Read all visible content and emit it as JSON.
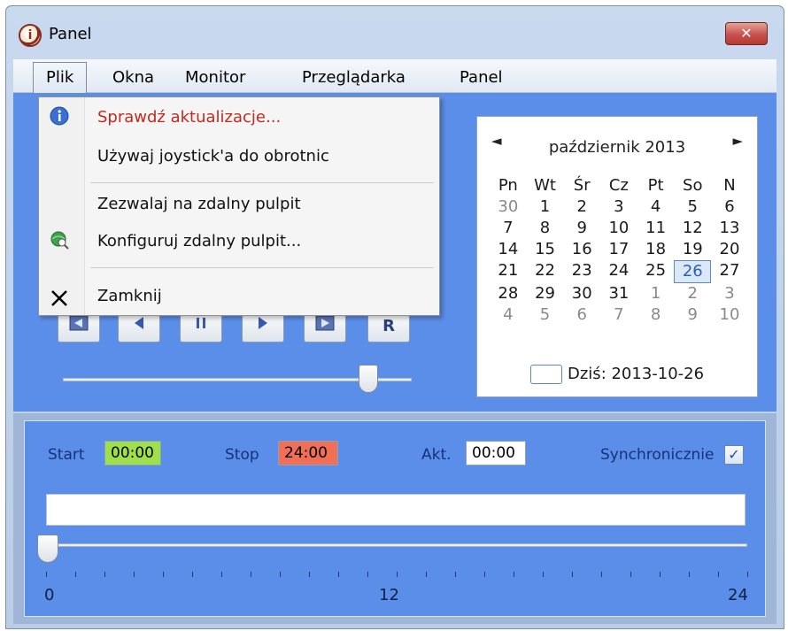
{
  "window": {
    "title": "Panel",
    "close_glyph": "✕"
  },
  "menu": {
    "items": [
      "Plik",
      "Okna",
      "Monitor",
      "Przeglądarka",
      "Panel"
    ]
  },
  "dropdown": {
    "items": [
      {
        "label": "Sprawdź aktualizacje...",
        "icon": "info-icon"
      },
      {
        "label": "Używaj joystick'a do obrotnic",
        "icon": ""
      },
      {
        "label": "Zezwalaj na zdalny pulpit",
        "icon": ""
      },
      {
        "label": "Konfiguruj zdalny pulpit...",
        "icon": "globe-search-icon"
      },
      {
        "label": "Zamknij",
        "icon": "close-x-icon"
      }
    ]
  },
  "calendar": {
    "prev_glyph": "◄",
    "next_glyph": "►",
    "month": "październik 2013",
    "weekdays": [
      "Pn",
      "Wt",
      "Śr",
      "Cz",
      "Pt",
      "So",
      "N"
    ],
    "days": [
      "30",
      "1",
      "2",
      "3",
      "4",
      "5",
      "6",
      "7",
      "8",
      "9",
      "10",
      "11",
      "12",
      "13",
      "14",
      "15",
      "16",
      "17",
      "18",
      "19",
      "20",
      "21",
      "22",
      "23",
      "24",
      "25",
      "26",
      "27",
      "28",
      "29",
      "30",
      "31",
      "1",
      "2",
      "3",
      "4",
      "5",
      "6",
      "7",
      "8",
      "9",
      "10"
    ],
    "today": "Dziś: 2013-10-26"
  },
  "controls": {
    "record_label": "R"
  },
  "timeline": {
    "start_label": "Start",
    "start_value": "00:00",
    "stop_label": "Stop",
    "stop_value": "24:00",
    "akt_label": "Akt.",
    "akt_value": "00:00",
    "sync_label": "Synchronicznie",
    "sync_checked": true,
    "scale": [
      "0",
      "12",
      "24"
    ]
  },
  "colors": {
    "start_box": "#9ee04a",
    "stop_box": "#f16f55",
    "akt_box": "#ffffff",
    "panel_blue": "#5b8ee8"
  }
}
